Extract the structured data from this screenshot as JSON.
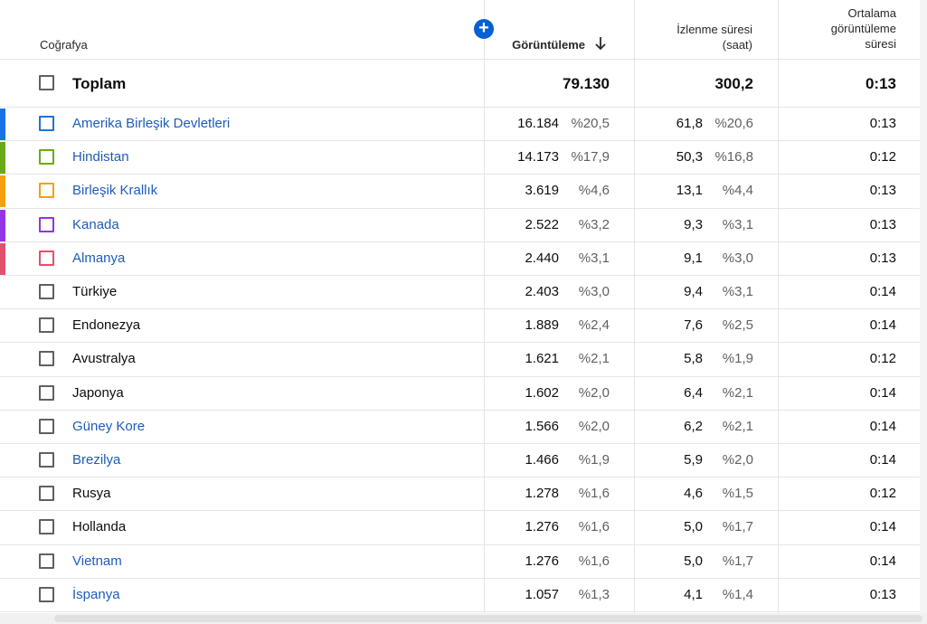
{
  "header": {
    "geography": "Coğrafya",
    "views": "Görüntüleme",
    "watch_time_line1": "İzlenme süresi",
    "watch_time_line2": "(saat)",
    "avg_line1": "Ortalama",
    "avg_line2": "görüntüleme",
    "avg_line3": "süresi",
    "add_button": "+",
    "sort_icon": "arrow-down-icon"
  },
  "total": {
    "label": "Toplam",
    "views": "79.130",
    "watch_time": "300,2",
    "avg": "0:13"
  },
  "colors": {
    "link": "#1f5cb8",
    "add_button": "#065fd4",
    "series": [
      "#1a73e8",
      "#6aaa18",
      "#f5a00f",
      "#9334e6",
      "#e3506e"
    ]
  },
  "rows": [
    {
      "name": "Amerika Birleşik Devletleri",
      "views": "16.184",
      "views_pct": "%20,5",
      "watch": "61,8",
      "watch_pct": "%20,6",
      "avg": "0:13"
    },
    {
      "name": "Hindistan",
      "views": "14.173",
      "views_pct": "%17,9",
      "watch": "50,3",
      "watch_pct": "%16,8",
      "avg": "0:12"
    },
    {
      "name": "Birleşik Krallık",
      "views": "3.619",
      "views_pct": "%4,6",
      "watch": "13,1",
      "watch_pct": "%4,4",
      "avg": "0:13"
    },
    {
      "name": "Kanada",
      "views": "2.522",
      "views_pct": "%3,2",
      "watch": "9,3",
      "watch_pct": "%3,1",
      "avg": "0:13"
    },
    {
      "name": "Almanya",
      "views": "2.440",
      "views_pct": "%3,1",
      "watch": "9,1",
      "watch_pct": "%3,0",
      "avg": "0:13"
    },
    {
      "name": "Türkiye",
      "views": "2.403",
      "views_pct": "%3,0",
      "watch": "9,4",
      "watch_pct": "%3,1",
      "avg": "0:14"
    },
    {
      "name": "Endonezya",
      "views": "1.889",
      "views_pct": "%2,4",
      "watch": "7,6",
      "watch_pct": "%2,5",
      "avg": "0:14"
    },
    {
      "name": "Avustralya",
      "views": "1.621",
      "views_pct": "%2,1",
      "watch": "5,8",
      "watch_pct": "%1,9",
      "avg": "0:12"
    },
    {
      "name": "Japonya",
      "views": "1.602",
      "views_pct": "%2,0",
      "watch": "6,4",
      "watch_pct": "%2,1",
      "avg": "0:14"
    },
    {
      "name": "Güney Kore",
      "views": "1.566",
      "views_pct": "%2,0",
      "watch": "6,2",
      "watch_pct": "%2,1",
      "avg": "0:14"
    },
    {
      "name": "Brezilya",
      "views": "1.466",
      "views_pct": "%1,9",
      "watch": "5,9",
      "watch_pct": "%2,0",
      "avg": "0:14"
    },
    {
      "name": "Rusya",
      "views": "1.278",
      "views_pct": "%1,6",
      "watch": "4,6",
      "watch_pct": "%1,5",
      "avg": "0:12"
    },
    {
      "name": "Hollanda",
      "views": "1.276",
      "views_pct": "%1,6",
      "watch": "5,0",
      "watch_pct": "%1,7",
      "avg": "0:14"
    },
    {
      "name": "Vietnam",
      "views": "1.276",
      "views_pct": "%1,6",
      "watch": "5,0",
      "watch_pct": "%1,7",
      "avg": "0:14"
    },
    {
      "name": "İspanya",
      "views": "1.057",
      "views_pct": "%1,3",
      "watch": "4,1",
      "watch_pct": "%1,4",
      "avg": "0:13"
    }
  ]
}
